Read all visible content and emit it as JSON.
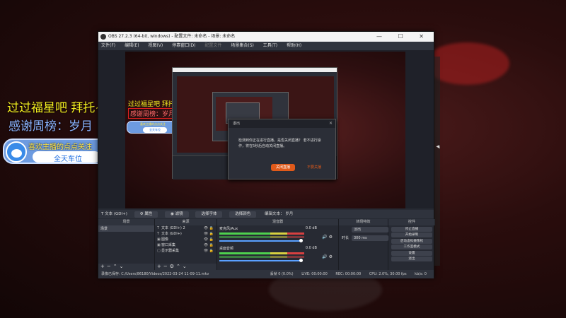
{
  "overlay": {
    "title": "过过福星吧  拜托~",
    "thanks": "感谢周榜：岁月",
    "follow_line": "喜欢主播的点点关注",
    "follow_pill": "全天车位"
  },
  "obs": {
    "window_title": "OBS 27.2.3 (64-bit, windows) - 配置文件: 未命名 - 场景: 未命名",
    "window_controls": "— ☐ ✕",
    "menu": [
      "文件(F)",
      "编辑(E)",
      "视图(V)",
      "停靠窗口(D)",
      "配置文件",
      "场景集合(S)",
      "工具(T)",
      "帮助(H)"
    ],
    "preview_inner": {
      "overlay_title": "过过福星吧  拜托~",
      "overlay_thanks": "感谢周榜：岁月",
      "follow_line": "喜欢主播的点点关注",
      "follow_pill": "全天车位"
    },
    "dialog": {
      "title": "退出",
      "message": "检测到你正在进行直播，是否关闭直播？ 若不进行操作，将在5秒后自动关闭直播。",
      "primary": "关闭直播",
      "secondary": "不要关播"
    },
    "context_bar": {
      "source": "文本 (GDI+)",
      "properties": "属性",
      "filters": "滤镜",
      "choose_font": "选择字体",
      "choose_color": "选择颜色",
      "text_label": "编辑文本：",
      "text_value": "岁月"
    },
    "docks": {
      "scenes_header": "场景",
      "scenes": [
        "场景"
      ],
      "sources_header": "来源",
      "sources": [
        {
          "icon": "T",
          "label": "文本 (GDI+) 2"
        },
        {
          "icon": "T",
          "label": "文本 (GDI+)"
        },
        {
          "icon": "▣",
          "label": "图像"
        },
        {
          "icon": "▣",
          "label": "窗口采集"
        },
        {
          "icon": "▢",
          "label": "显示器采集"
        }
      ],
      "mixer_header": "混音器",
      "mixer": [
        {
          "name": "麦克风/Aux",
          "db": "0.0 dB"
        },
        {
          "name": "桌面音频",
          "db": "0.0 dB"
        }
      ],
      "transitions_header": "转场特效",
      "transition_type": "淡出",
      "duration_label": "时长",
      "duration_value": "300 ms",
      "controls_header": "控件",
      "controls": [
        "停止直播",
        "开始录制",
        "启动虚拟摄像机",
        "工作室模式",
        "设置",
        "退出"
      ]
    },
    "statusbar": {
      "recording_path": "录像已保存: C:/Users/86180/Videos/2022-03-24 11-09-11.mkv",
      "dropped": "丢帧 0 (0.0%)",
      "live": "LIVE: 00:00:00",
      "rec": "REC: 00:00:00",
      "cpu": "CPU: 2.0%, 30.00 fps",
      "kbps": "kb/s: 0"
    }
  }
}
